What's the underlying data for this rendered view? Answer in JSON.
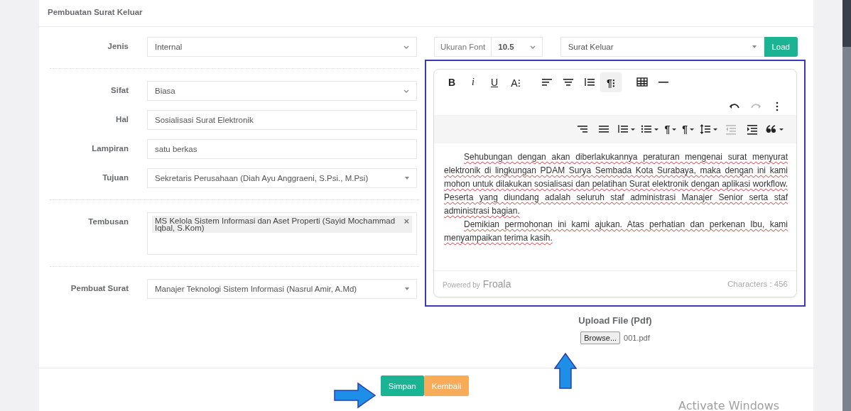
{
  "card": {
    "title": "Pembuatan Surat Keluar"
  },
  "form": [
    {
      "kind": "select",
      "label": "Jenis",
      "value": "Internal"
    },
    {
      "kind": "divider"
    },
    {
      "kind": "select",
      "label": "Sifat",
      "value": "Biasa"
    },
    {
      "kind": "text",
      "label": "Hal",
      "value": "Sosialisasi Surat Elektronik"
    },
    {
      "kind": "text",
      "label": "Lampiran",
      "value": "satu berkas"
    },
    {
      "kind": "combobox",
      "label": "Tujuan",
      "value": "Sekretaris Perusahaan (Diah Ayu Anggraeni, S.Psi., M.Psi)"
    },
    {
      "kind": "divider"
    },
    {
      "kind": "tags",
      "label": "Tembusan",
      "tags": [
        "MS Kelola Sistem Informasi dan Aset Properti (Sayid Mochammad Iqbal, S.Kom)"
      ],
      "remove": "×"
    },
    {
      "kind": "divider"
    },
    {
      "kind": "combobox",
      "label": "Pembuat Surat",
      "value": "Manajer Teknologi Sistem Informasi (Nasrul Amir, A.Md)"
    }
  ],
  "font_size": {
    "label": "Ukuran Font",
    "value": "10.5"
  },
  "template": {
    "value": "Surat Keluar",
    "button": "Load"
  },
  "editor": {
    "toolbar_main": [
      {
        "kind": "bold",
        "label": "B",
        "selected": false,
        "disabled": false
      },
      {
        "kind": "italic",
        "label": "i",
        "selected": false,
        "disabled": false
      },
      {
        "kind": "underline",
        "label": "U",
        "selected": false,
        "disabled": false
      },
      {
        "kind": "font-size",
        "label": "A⁝",
        "selected": false,
        "disabled": false
      },
      {
        "kind": "align-left",
        "selected": false,
        "disabled": false
      },
      {
        "kind": "align-center",
        "selected": false,
        "disabled": false
      },
      {
        "kind": "ordered-list",
        "selected": false,
        "disabled": false
      },
      {
        "kind": "paragraph-more",
        "label": "¶⁝",
        "selected": true,
        "disabled": false
      },
      {
        "kind": "table",
        "selected": false,
        "disabled": false
      },
      {
        "kind": "hr",
        "selected": false,
        "disabled": false
      }
    ],
    "toolbar_history": [
      {
        "kind": "undo",
        "disabled": false
      },
      {
        "kind": "redo",
        "disabled": true
      },
      {
        "kind": "more",
        "disabled": false
      }
    ],
    "toolbar_more": [
      {
        "kind": "align-right",
        "dropdown": false,
        "disabled": false
      },
      {
        "kind": "justify",
        "dropdown": false,
        "disabled": false
      },
      {
        "kind": "ordered-list",
        "dropdown": true,
        "disabled": false
      },
      {
        "kind": "unordered-list",
        "dropdown": true,
        "disabled": false
      },
      {
        "kind": "paragraph",
        "label": "¶",
        "dropdown": true,
        "disabled": false
      },
      {
        "kind": "paragraph-style",
        "label": "¶",
        "dropdown": true,
        "disabled": false
      },
      {
        "kind": "line-height",
        "dropdown": true,
        "disabled": false
      },
      {
        "kind": "outdent",
        "dropdown": false,
        "disabled": true
      },
      {
        "kind": "indent",
        "dropdown": false,
        "disabled": false
      },
      {
        "kind": "quote",
        "dropdown": true,
        "disabled": false
      }
    ],
    "paragraphs": [
      "Sehubungan dengan akan diberlakukannya peraturan mengenai surat menyurat elektronik di lingkungan PDAM Surya Sembada Kota Surabaya, maka dengan ini kami mohon untuk dilakukan sosialisasi dan pelatihan Surat elektronik dengan aplikasi workflow. Peserta yang diundang adalah seluruh staf administrasi Manajer Senior serta staf administrasi bagian.",
      "Demikian permohonan ini kami ajukan. Atas perhatian dan perkenan Ibu, kami menyampaikan terima kasih."
    ],
    "powered_by": "Powered by",
    "brand": "Froala",
    "characters": "Characters : 456"
  },
  "upload": {
    "title": "Upload File (Pdf)",
    "button": "Browse...",
    "file": "001.pdf"
  },
  "actions": [
    {
      "label": "Simpan",
      "kind": "primary"
    },
    {
      "label": "Kembali",
      "kind": "warning"
    }
  ],
  "annotations": [
    {
      "kind": "arrow-right"
    },
    {
      "kind": "arrow-up"
    }
  ],
  "os_notice": "Activate Windows"
}
